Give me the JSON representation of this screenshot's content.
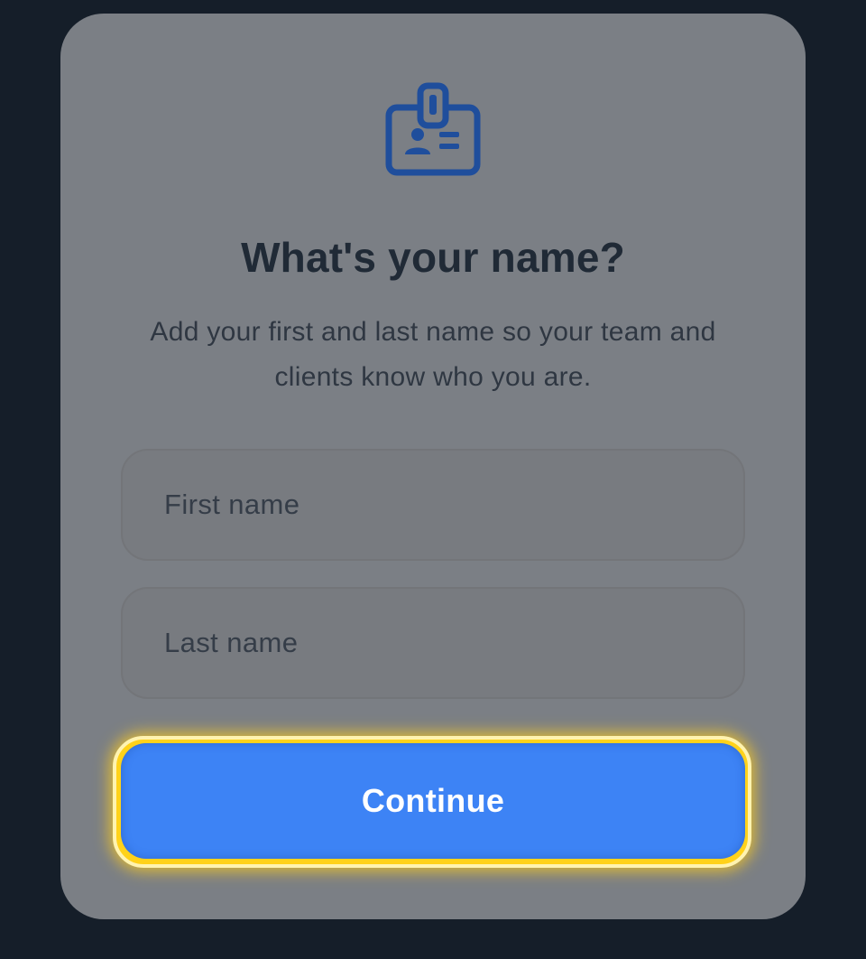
{
  "onboarding": {
    "title": "What's your name?",
    "subtitle": "Add your first and last name so your team and clients know who you are.",
    "first_name_field": {
      "value": "",
      "placeholder": "First name"
    },
    "last_name_field": {
      "value": "",
      "placeholder": "Last name"
    },
    "continue_label": "Continue",
    "icon": "id-badge-icon"
  },
  "colors": {
    "background": "#151e29",
    "card": "#7b7f85",
    "icon": "#1f4e9c",
    "primary_button": "#3d83f5",
    "focus_ring": "#ffd21a"
  }
}
